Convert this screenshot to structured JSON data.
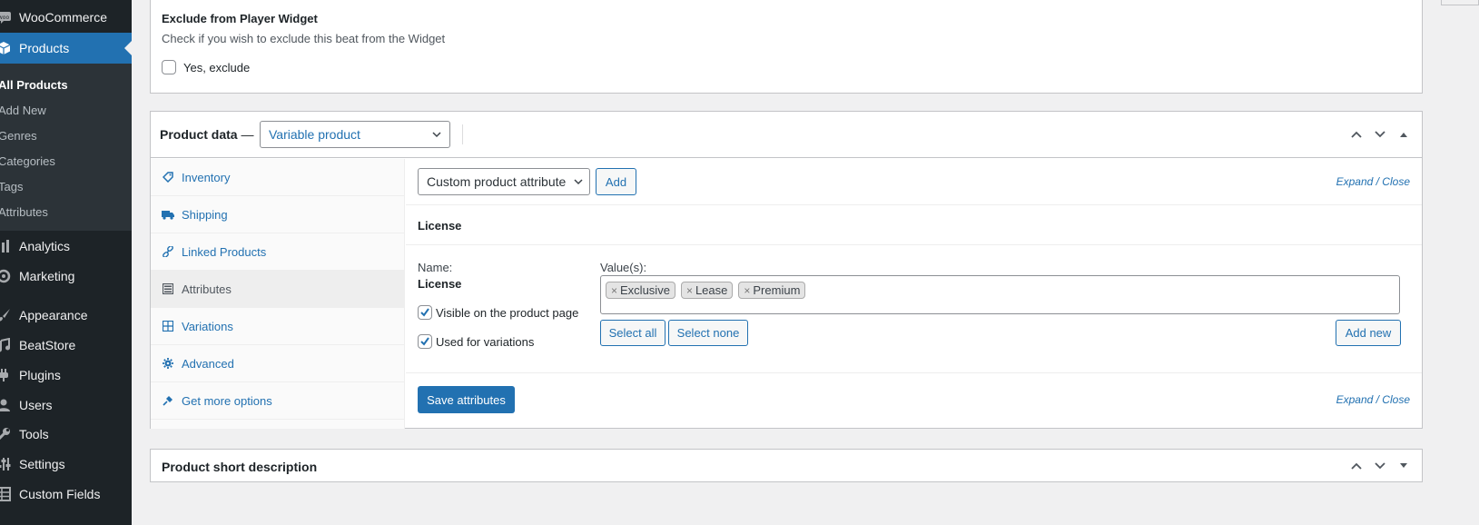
{
  "sidebar": {
    "items_top": [
      {
        "key": "woocommerce",
        "label": "WooCommerce",
        "icon": "woo-icon"
      },
      {
        "key": "products",
        "label": "Products",
        "icon": "cube-icon",
        "current": true
      }
    ],
    "submenu": [
      {
        "label": "All Products",
        "current": true
      },
      {
        "label": "Add New"
      },
      {
        "label": "Genres"
      },
      {
        "label": "Categories"
      },
      {
        "label": "Tags"
      },
      {
        "label": "Attributes"
      }
    ],
    "items_bottom": [
      {
        "key": "analytics",
        "label": "Analytics",
        "icon": "bar-chart-icon"
      },
      {
        "key": "marketing",
        "label": "Marketing",
        "icon": "megaphone-icon"
      },
      {
        "key": "appearance",
        "label": "Appearance",
        "icon": "paintbrush-icon"
      },
      {
        "key": "beatstore",
        "label": "BeatStore",
        "icon": "music-note-icon"
      },
      {
        "key": "plugins",
        "label": "Plugins",
        "icon": "plug-icon"
      },
      {
        "key": "users",
        "label": "Users",
        "icon": "users-icon"
      },
      {
        "key": "tools",
        "label": "Tools",
        "icon": "wrench-icon"
      },
      {
        "key": "settings",
        "label": "Settings",
        "icon": "settings-sliders-icon"
      },
      {
        "key": "custom_fields",
        "label": "Custom Fields",
        "icon": "grid-icon"
      }
    ]
  },
  "widget_box": {
    "title": "Exclude from Player Widget",
    "description": "Check if you wish to exclude this beat from the Widget",
    "checkbox_label": "Yes, exclude",
    "checked": false
  },
  "product_data": {
    "title": "Product data",
    "dash": "—",
    "type_value": "Variable product",
    "tabs": [
      {
        "label": "Inventory",
        "icon": "tag-icon"
      },
      {
        "label": "Shipping",
        "icon": "truck-icon"
      },
      {
        "label": "Linked Products",
        "icon": "link-icon"
      },
      {
        "label": "Attributes",
        "icon": "list-icon",
        "active": true
      },
      {
        "label": "Variations",
        "icon": "table-icon"
      },
      {
        "label": "Advanced",
        "icon": "gear-icon"
      },
      {
        "label": "Get more options",
        "icon": "plugin-icon"
      }
    ],
    "attributes": {
      "select_value": "Custom product attribute",
      "add_label": "Add",
      "expand_close": "Expand / Close",
      "attribute_title": "License",
      "name_label": "Name:",
      "name_value": "License",
      "values_label": "Value(s):",
      "values": [
        "Exclusive",
        "Lease",
        "Premium"
      ],
      "visible_label": "Visible on the product page",
      "visible_checked": true,
      "variations_label": "Used for variations",
      "variations_checked": true,
      "select_all": "Select all",
      "select_none": "Select none",
      "add_new": "Add new",
      "save_label": "Save attributes",
      "expand_close_bottom": "Expand / Close"
    }
  },
  "short_description": {
    "title": "Product short description"
  },
  "colors": {
    "sidebar_bg": "#1d2327",
    "submenu_bg": "#2c3338",
    "accent": "#2271b1",
    "page_bg": "#f0f0f1"
  }
}
